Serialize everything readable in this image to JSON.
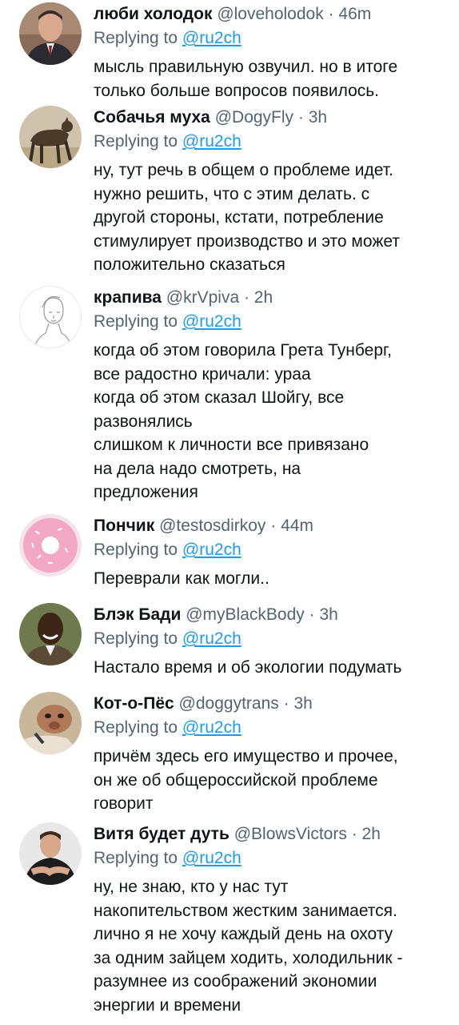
{
  "tweets": [
    {
      "name": "люби холодок",
      "handle": "@loveholodok",
      "time": "46m",
      "replying_label": "Replying to",
      "replying_to": "@ru2ch",
      "lines": [
        "мысль правильную озвучил. но в итоге",
        "только больше вопросов появилось."
      ],
      "avatar": "man-in-suit-photo"
    },
    {
      "name": "Собачья муха",
      "handle": "@DogyFly",
      "time": "3h",
      "replying_label": "Replying to",
      "replying_to": "@ru2ch",
      "lines": [
        "ну, тут речь в общем о проблеме идет.",
        "нужно решить, что с этим делать. с",
        "другой стороны, кстати, потребление",
        "стимулирует производство и это может",
        "положительно сказаться"
      ],
      "avatar": "dog-photo"
    },
    {
      "name": "крапива",
      "handle": "@krVpiva",
      "time": "2h",
      "replying_label": "Replying to",
      "replying_to": "@ru2ch",
      "lines": [
        "когда об этом говорила Грета Тунберг,",
        "все радостно кричали: ураа",
        "когда об этом сказал Шойгу, все",
        "развонялись",
        "слишком к личности все привязано",
        "на дела надо смотреть, на",
        "предложения"
      ],
      "avatar": "line-art-portrait"
    },
    {
      "name": "Пончик",
      "handle": "@testosdirkoy",
      "time": "44m",
      "replying_label": "Replying to",
      "replying_to": "@ru2ch",
      "lines": [
        "Переврали как могли.."
      ],
      "avatar": "donut-photo"
    },
    {
      "name": "Блэк Бади",
      "handle": "@myBlackBody",
      "time": "3h",
      "replying_label": "Replying to",
      "replying_to": "@ru2ch",
      "lines": [
        "Настало время и об экологии подумать"
      ],
      "avatar": "smiling-man-photo"
    },
    {
      "name": "Кот-о-Пёс",
      "handle": "@doggytrans",
      "time": "3h",
      "replying_label": "Replying to",
      "replying_to": "@ru2ch",
      "lines": [
        "причём здесь его имущество и прочее,",
        "он же об общероссийской проблеме",
        "говорит"
      ],
      "avatar": "pitbull-photo"
    },
    {
      "name": "Витя будет дуть",
      "handle": "@BlowsVictors",
      "time": "2h",
      "replying_label": "Replying to",
      "replying_to": "@ru2ch",
      "lines": [
        "ну, не знаю, кто у нас тут",
        "накопительством жестким занимается.",
        "лично я не хочу каждый день на охоту",
        "за одним зайцем ходить, холодильник -",
        "разумнее из соображений экономии",
        "энергии и времени"
      ],
      "avatar": "man-portrait-photo"
    }
  ]
}
